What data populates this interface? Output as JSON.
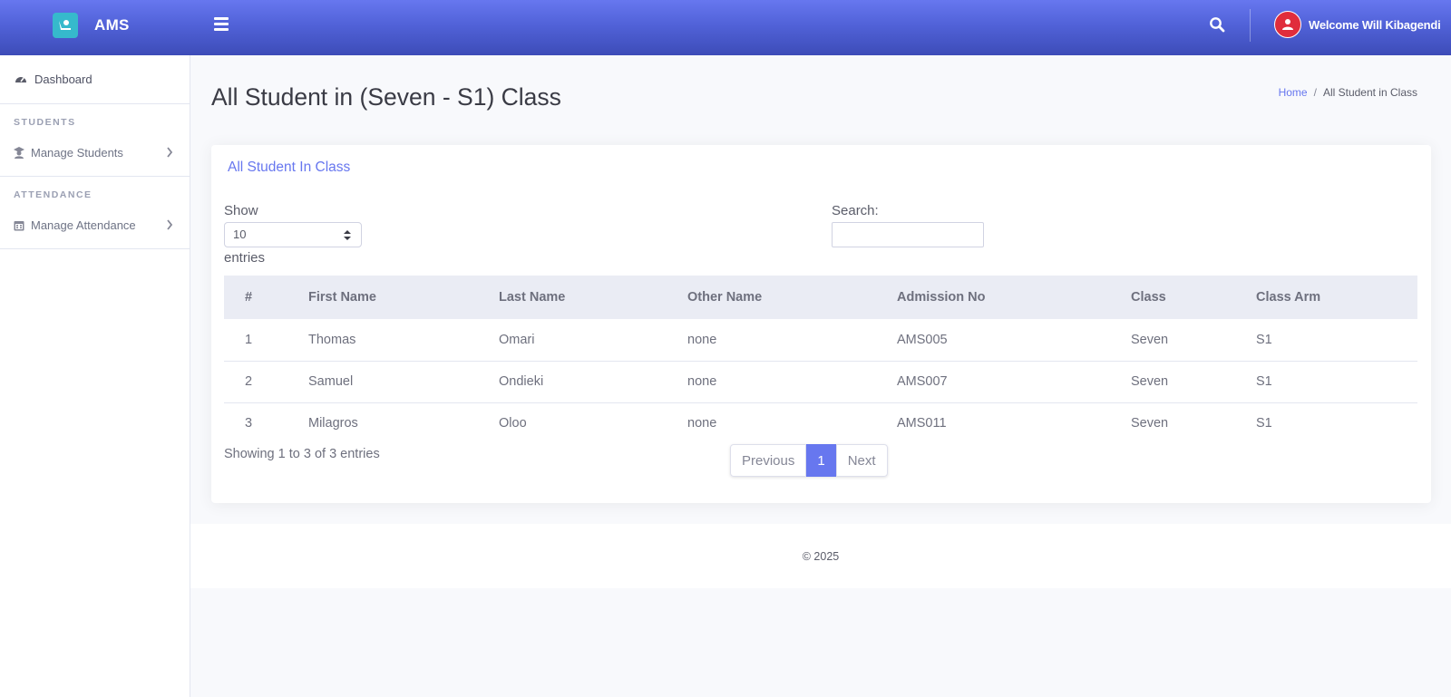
{
  "header": {
    "brand": "AMS",
    "user_greeting": "Welcome Will Kibagendi"
  },
  "sidebar": {
    "dashboard": {
      "label": "Dashboard",
      "icon": "tachometer-icon"
    },
    "sections": [
      {
        "heading": "STUDENTS",
        "item": {
          "label": "Manage Students",
          "icon": "graduate-icon"
        }
      },
      {
        "heading": "ATTENDANCE",
        "item": {
          "label": "Manage Attendance",
          "icon": "calendar-icon"
        }
      }
    ]
  },
  "page": {
    "title": "All Student in (Seven - S1) Class",
    "breadcrumb": {
      "home": "Home",
      "separator": "/",
      "current": "All Student in Class"
    }
  },
  "card": {
    "title": "All Student In Class",
    "length": {
      "label_before": "Show",
      "value": "10",
      "label_after": "entries"
    },
    "search": {
      "label": "Search:",
      "value": "",
      "placeholder": ""
    },
    "columns": [
      "#",
      "First Name",
      "Last Name",
      "Other Name",
      "Admission No",
      "Class",
      "Class Arm"
    ],
    "rows": [
      [
        "1",
        "Thomas",
        "Omari",
        "none",
        "AMS005",
        "Seven",
        "S1"
      ],
      [
        "2",
        "Samuel",
        "Ondieki",
        "none",
        "AMS007",
        "Seven",
        "S1"
      ],
      [
        "3",
        "Milagros",
        "Oloo",
        "none",
        "AMS011",
        "Seven",
        "S1"
      ]
    ],
    "info": "Showing 1 to 3 of 3 entries",
    "pagination": {
      "previous": "Previous",
      "current": "1",
      "next": "Next"
    }
  },
  "footer": {
    "text": "© 2025"
  },
  "colors": {
    "primary": "#6777ef",
    "avatar": "#e02d3c",
    "logo": "#36b9cc"
  }
}
